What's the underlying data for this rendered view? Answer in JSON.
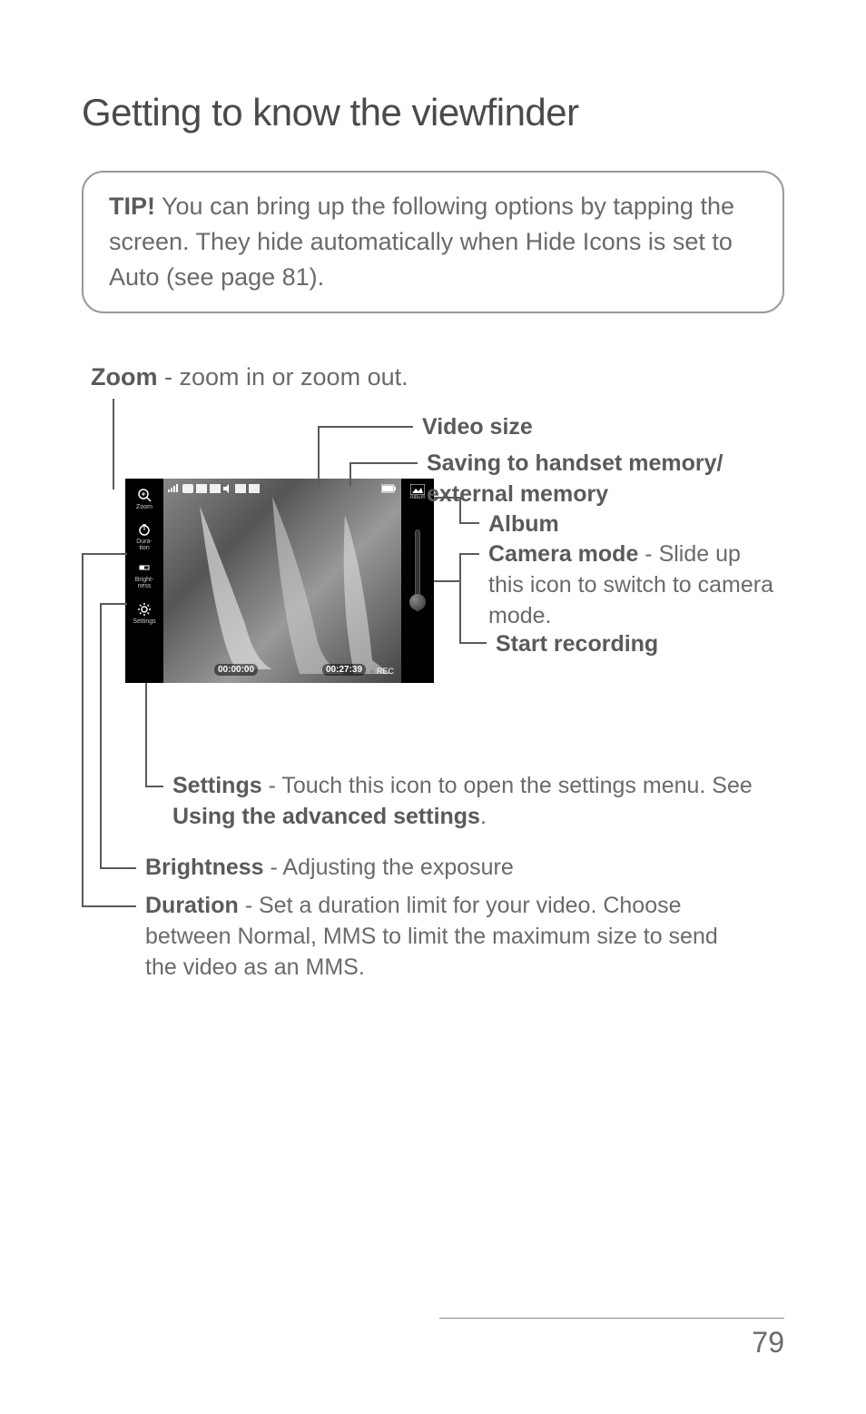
{
  "page_title": "Getting to know the viewfinder",
  "tip": {
    "label": "TIP!",
    "text": " You can bring up the following options by tapping the screen. They hide automatically when Hide Icons is set to Auto (see page 81)."
  },
  "zoom": {
    "label": "Zoom",
    "text": " - zoom in or zoom out."
  },
  "callouts": {
    "video_size": "Video size",
    "saving": "Saving to handset memory/ external memory",
    "album": "Album",
    "camera_mode_label": "Camera mode",
    "camera_mode_text": " - Slide up this icon to switch to camera mode.",
    "start_recording": "Start recording"
  },
  "lower": {
    "settings_label": "Settings",
    "settings_text_a": " - Touch this icon to open the settings menu. See ",
    "settings_ref": "Using the advanced settings",
    "settings_text_b": ".",
    "brightness_label": "Brightness",
    "brightness_text": " - Adjusting the exposure",
    "duration_label": "Duration",
    "duration_text": " - Set a duration limit for your video. Choose between Normal, MMS to limit the maximum size to send the video as an MMS."
  },
  "screenshot": {
    "side_labels": {
      "zoom": "Zoom",
      "duration": "Dura-\ntion",
      "brightness": "Bright-\nness",
      "settings": "Settings",
      "album": "Album"
    },
    "time_elapsed": "00:00:00",
    "time_remaining": "00:27:39",
    "rec": "REC"
  },
  "page_number": "79"
}
